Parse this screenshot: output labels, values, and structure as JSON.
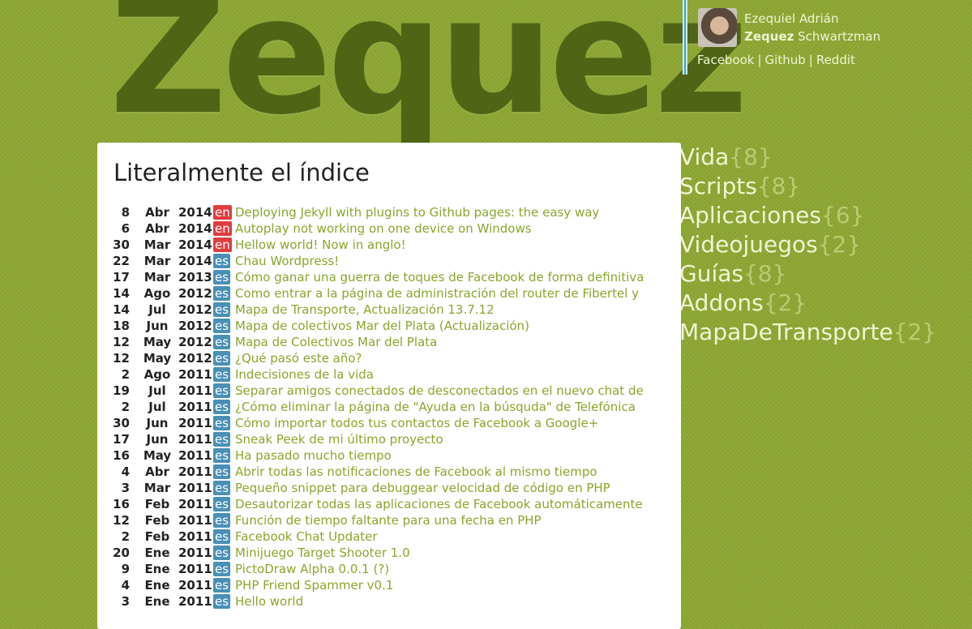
{
  "site": {
    "logo": "Zequez"
  },
  "author": {
    "first_name": "Ezequiel Adrián",
    "nickname": "Zequez",
    "last_name": "Schwartzman",
    "links": [
      "Facebook",
      "Github",
      "Reddit"
    ],
    "separator": "|"
  },
  "main": {
    "title": "Literalmente el índice"
  },
  "posts": [
    {
      "day": "8",
      "month": "Abr",
      "year": "2014",
      "lang": "en",
      "title": "Deploying Jekyll with plugins to Github pages: the easy way"
    },
    {
      "day": "6",
      "month": "Abr",
      "year": "2014",
      "lang": "en",
      "title": "Autoplay not working on one device on Windows"
    },
    {
      "day": "30",
      "month": "Mar",
      "year": "2014",
      "lang": "en",
      "title": "Hellow world! Now in anglo!"
    },
    {
      "day": "22",
      "month": "Mar",
      "year": "2014",
      "lang": "es",
      "title": "Chau Wordpress!"
    },
    {
      "day": "17",
      "month": "Mar",
      "year": "2013",
      "lang": "es",
      "title": "Cómo ganar una guerra de toques de Facebook de forma definitiva"
    },
    {
      "day": "14",
      "month": "Ago",
      "year": "2012",
      "lang": "es",
      "title": "Como entrar a la página de administración del router de Fibertel y"
    },
    {
      "day": "14",
      "month": "Jul",
      "year": "2012",
      "lang": "es",
      "title": "Mapa de Transporte, Actualización 13.7.12"
    },
    {
      "day": "18",
      "month": "Jun",
      "year": "2012",
      "lang": "es",
      "title": "Mapa de colectivos Mar del Plata (Actualización)"
    },
    {
      "day": "12",
      "month": "May",
      "year": "2012",
      "lang": "es",
      "title": "Mapa de Colectivos Mar del Plata"
    },
    {
      "day": "12",
      "month": "May",
      "year": "2012",
      "lang": "es",
      "title": "¿Qué pasó este año?"
    },
    {
      "day": "2",
      "month": "Ago",
      "year": "2011",
      "lang": "es",
      "title": "Indecisiones de la vida"
    },
    {
      "day": "19",
      "month": "Jul",
      "year": "2011",
      "lang": "es",
      "title": "Separar amigos conectados de desconectados en el nuevo chat de"
    },
    {
      "day": "2",
      "month": "Jul",
      "year": "2011",
      "lang": "es",
      "title": "¿Cómo eliminar la página de \"Ayuda en la búsquda\" de Telefónica"
    },
    {
      "day": "30",
      "month": "Jun",
      "year": "2011",
      "lang": "es",
      "title": "Cómo importar todos tus contactos de Facebook a Google+"
    },
    {
      "day": "17",
      "month": "Jun",
      "year": "2011",
      "lang": "es",
      "title": "Sneak Peek de mi último proyecto"
    },
    {
      "day": "16",
      "month": "May",
      "year": "2011",
      "lang": "es",
      "title": "Ha pasado mucho tiempo"
    },
    {
      "day": "4",
      "month": "Abr",
      "year": "2011",
      "lang": "es",
      "title": "Abrir todas las notificaciones de Facebook al mismo tiempo"
    },
    {
      "day": "3",
      "month": "Mar",
      "year": "2011",
      "lang": "es",
      "title": "Pequeño snippet para debuggear velocidad de código en PHP"
    },
    {
      "day": "16",
      "month": "Feb",
      "year": "2011",
      "lang": "es",
      "title": "Desautorizar todas las aplicaciones de Facebook automáticamente"
    },
    {
      "day": "12",
      "month": "Feb",
      "year": "2011",
      "lang": "es",
      "title": "Función de tiempo faltante para una fecha en PHP"
    },
    {
      "day": "2",
      "month": "Feb",
      "year": "2011",
      "lang": "es",
      "title": "Facebook Chat Updater"
    },
    {
      "day": "20",
      "month": "Ene",
      "year": "2011",
      "lang": "es",
      "title": "Minijuego Target Shooter 1.0"
    },
    {
      "day": "9",
      "month": "Ene",
      "year": "2011",
      "lang": "es",
      "title": "PictoDraw Alpha 0.0.1 (?)"
    },
    {
      "day": "4",
      "month": "Ene",
      "year": "2011",
      "lang": "es",
      "title": "PHP Friend Spammer v0.1"
    },
    {
      "day": "3",
      "month": "Ene",
      "year": "2011",
      "lang": "es",
      "title": "Hello world"
    }
  ],
  "categories": [
    {
      "name": "Vida",
      "count": "{8}"
    },
    {
      "name": "Scripts",
      "count": "{8}"
    },
    {
      "name": "Aplicaciones",
      "count": "{6}"
    },
    {
      "name": "Videojuegos",
      "count": "{2}"
    },
    {
      "name": "Guías",
      "count": "{8}"
    },
    {
      "name": "Addons",
      "count": "{2}"
    },
    {
      "name": "MapaDeTransporte",
      "count": "{2}"
    }
  ],
  "colors": {
    "background": "#8ea634",
    "logo": "#4f6515",
    "lang_en": "#e23d3d",
    "lang_es": "#4a8fb5",
    "post_link": "#8aa52c",
    "author_bar": "#3fa5c6"
  }
}
